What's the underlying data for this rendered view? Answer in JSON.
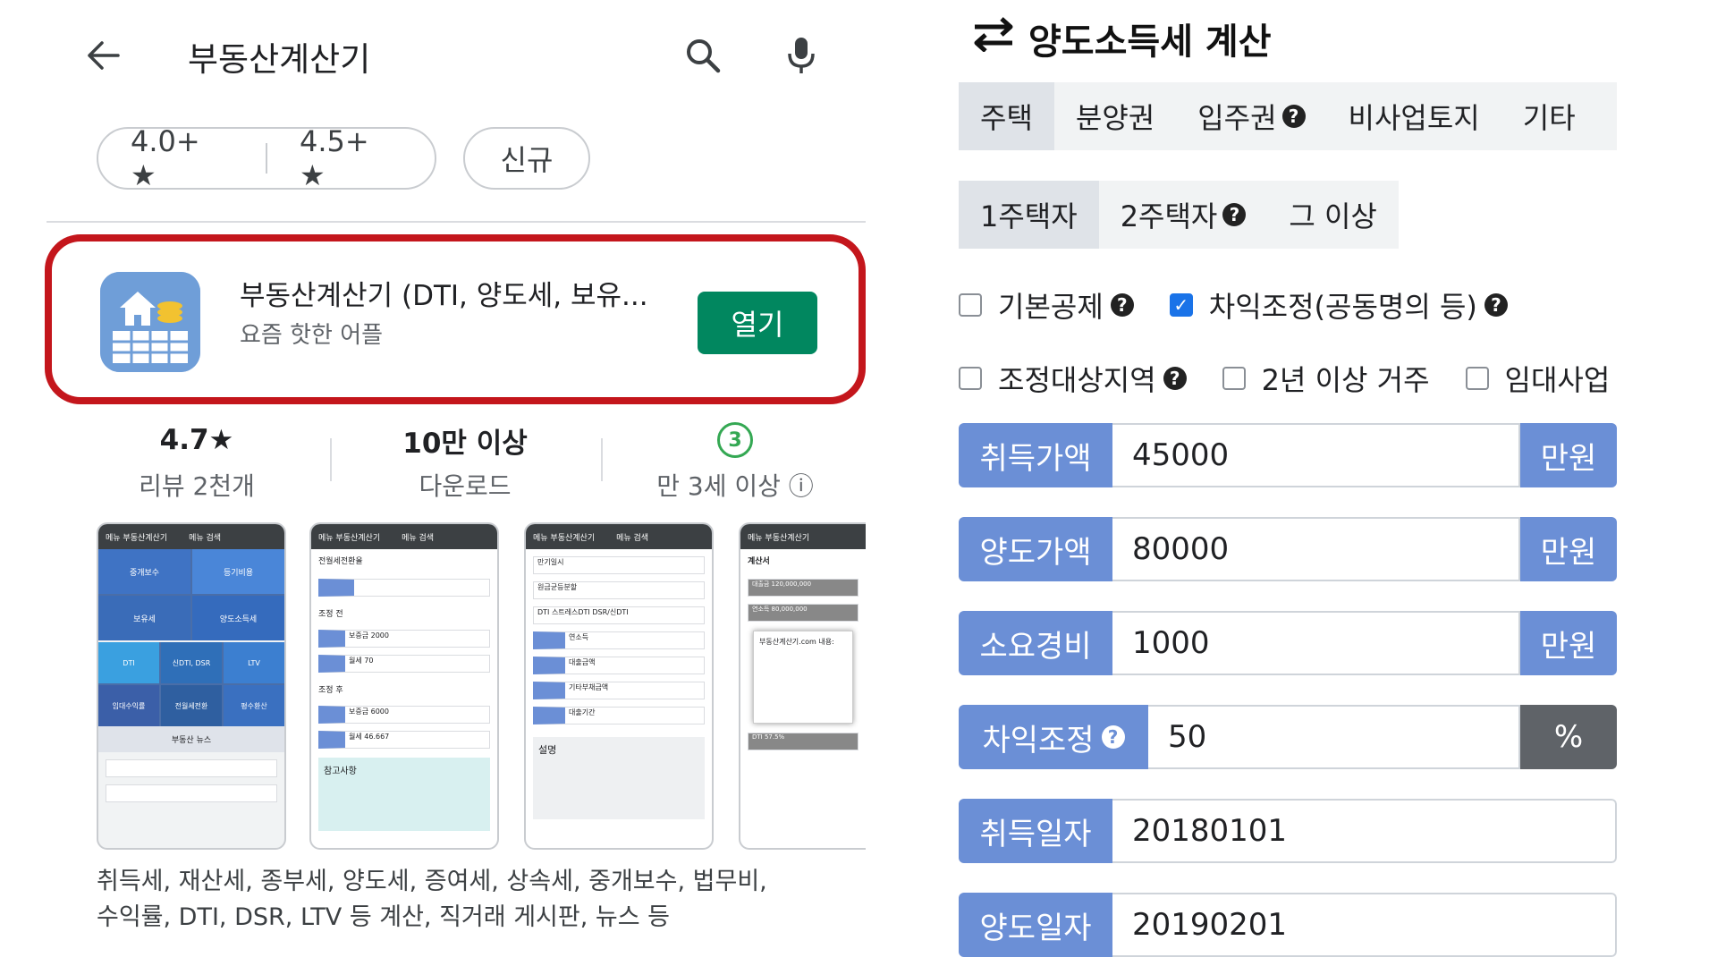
{
  "store": {
    "search_query": "부동산계산기",
    "filters": [
      "4.0+ ★",
      "4.5+ ★",
      "신규"
    ],
    "app": {
      "title": "부동산계산기 (DTI, 양도세, 보유...",
      "subtitle": "요즘 핫한 어플",
      "open_label": "열기"
    },
    "stats": [
      {
        "value": "4.7★",
        "label": "리뷰 2천개"
      },
      {
        "value": "10만 이상",
        "label": "다운로드"
      },
      {
        "value": "3",
        "label": "만 3세 이상 ⓘ"
      }
    ],
    "screenshots": [
      {
        "bar_left": "메뉴  부동산계산기",
        "bar_right": "메뉴 검색",
        "tiles": [
          "중개보수",
          "등기비용",
          "보유세",
          "양도소득세",
          "DTI",
          "신DTI, DSR",
          "LTV",
          "임대수익률",
          "전월세전환",
          "평수환산"
        ],
        "footer": "부동산 뉴스"
      },
      {
        "bar_left": "메뉴  부동산계산기",
        "bar_right": "메뉴 검색",
        "rows": [
          "전월세전환율",
          "조정 전",
          "보증금 2000",
          "월세 70",
          "조정 후",
          "보증금 6000",
          "월세 46.667"
        ],
        "footer": "참고사항"
      },
      {
        "bar_left": "메뉴  부동산계산기",
        "bar_right": "메뉴 검색",
        "rows": [
          "만기일시",
          "원금균등분할",
          "DTI 스트레스DTI DSR/신DTI",
          "연소득",
          "대출금액",
          "기타부채금액",
          "대출기간"
        ],
        "footer": "설명"
      },
      {
        "bar_left": "메뉴  부동산계산기",
        "bar_right": "",
        "rows": [
          "계산서",
          "대출금 120,000,000",
          "연소득 80,000,000",
          "부동산계산기.com 내용:",
          "DTI 57.5%"
        ],
        "footer": ""
      }
    ],
    "description_lines": [
      "취득세, 재산세, 종부세, 양도세, 증여세, 상속세, 중개보수, 법무비,",
      "수익률, DTI, DSR, LTV 등 계산, 직거래 게시판, 뉴스 등"
    ]
  },
  "calc": {
    "title": "양도소득세 계산",
    "type_tabs": [
      "주택",
      "분양권",
      "입주권",
      "비사업토지",
      "기타"
    ],
    "count_tabs": [
      "1주택자",
      "2주택자",
      "그 이상"
    ],
    "checks_row1": [
      {
        "label": "기본공제",
        "checked": false,
        "help": true
      },
      {
        "label": "차익조정(공동명의 등)",
        "checked": true,
        "help": true
      }
    ],
    "checks_row2": [
      {
        "label": "조정대상지역",
        "checked": false,
        "help": true
      },
      {
        "label": "2년 이상 거주",
        "checked": false,
        "help": false
      },
      {
        "label": "임대사업",
        "checked": false,
        "help": false
      }
    ],
    "fields": [
      {
        "label": "취득가액",
        "value": "45000",
        "unit": "만원"
      },
      {
        "label": "양도가액",
        "value": "80000",
        "unit": "만원"
      },
      {
        "label": "소요경비",
        "value": "1000",
        "unit": "만원"
      },
      {
        "label": "차익조정",
        "value": "50",
        "unit": "%"
      },
      {
        "label": "취득일자",
        "value": "20180101",
        "unit": ""
      },
      {
        "label": "양도일자",
        "value": "20190201",
        "unit": ""
      }
    ]
  }
}
